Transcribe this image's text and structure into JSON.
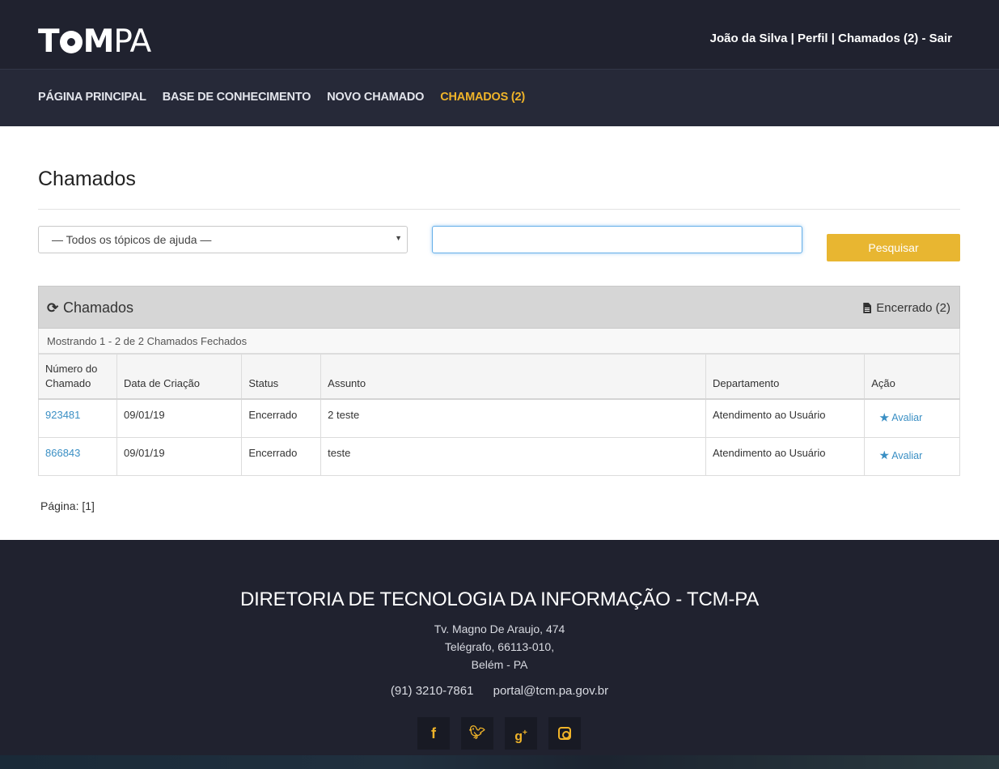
{
  "header": {
    "logo_text": "TCMPA",
    "user_name": "João da Silva",
    "separator": "|",
    "profile_link": "Perfil",
    "tickets_link": "Chamados (2)",
    "dash": "-",
    "logout_link": "Sair"
  },
  "nav": {
    "items": [
      {
        "label": "PÁGINA PRINCIPAL"
      },
      {
        "label": "BASE DE CONHECIMENTO"
      },
      {
        "label": "NOVO CHAMADO"
      },
      {
        "label": "CHAMADOS (2)"
      }
    ],
    "active_index": 3,
    "active_color": "#f0b429"
  },
  "main": {
    "title": "Chamados",
    "filter": {
      "topic_select_value": "— Todos os tópicos de ajuda —",
      "search_value": "",
      "search_button": "Pesquisar"
    },
    "panel": {
      "title": "Chamados",
      "closed_link": "Encerrado (2)",
      "showing_text": "Mostrando 1 - 2 de 2 Chamados Fechados"
    },
    "table": {
      "headers": [
        "Número do Chamado",
        "Data de Criação",
        "Status",
        "Assunto",
        "Departamento",
        "Ação"
      ],
      "rows": [
        {
          "number": "923481",
          "date": "09/01/19",
          "status": "Encerrado",
          "subject": "2 teste",
          "department": "Atendimento ao Usuário",
          "action": "Avaliar"
        },
        {
          "number": "866843",
          "date": "09/01/19",
          "status": "Encerrado",
          "subject": "teste",
          "department": "Atendimento ao Usuário",
          "action": "Avaliar"
        }
      ]
    },
    "pagination": "Página: [1]"
  },
  "footer": {
    "title": "DIRETORIA DE TECNOLOGIA DA INFORMAÇÃO - TCM-PA",
    "address_line1": "Tv. Magno De Araujo, 474",
    "address_line2": "Telégrafo, 66113-010,",
    "address_line3": "Belém - PA",
    "phone": "(91) 3210-7861",
    "email": "portal@tcm.pa.gov.br",
    "social": [
      "facebook-icon",
      "twitter-icon",
      "google-plus-icon",
      "instagram-icon"
    ]
  },
  "colors": {
    "header_bg": "#20222f",
    "nav_bg": "#262938",
    "accent": "#f0b429",
    "button": "#e8b631",
    "link": "#3a8fc4"
  }
}
